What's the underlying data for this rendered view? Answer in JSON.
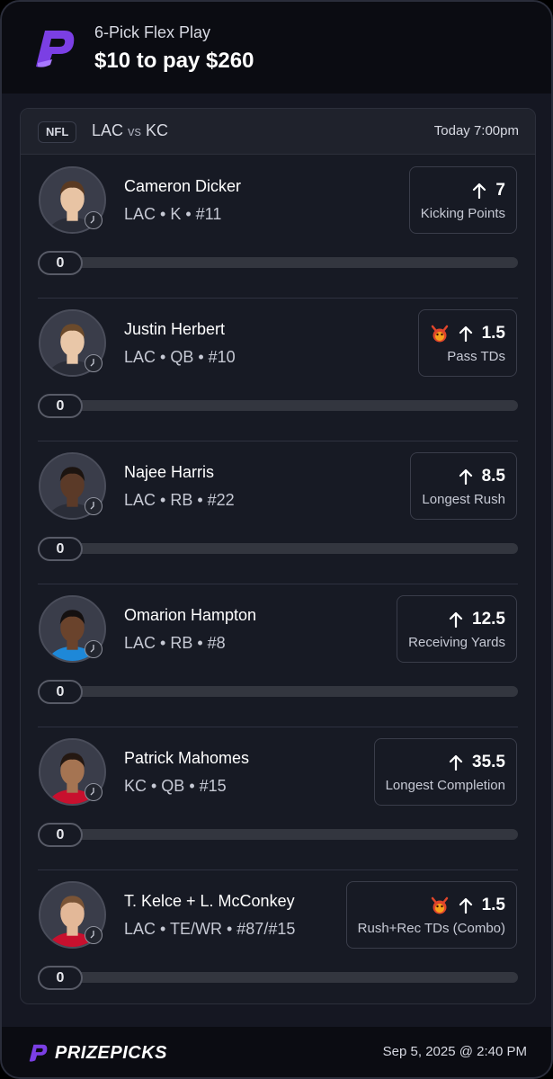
{
  "play": {
    "title": "6-Pick Flex Play",
    "stake": "$10 to pay $260"
  },
  "game": {
    "league": "NFL",
    "team_home": "LAC",
    "vs": "vs",
    "team_away": "KC",
    "time": "Today 7:00pm"
  },
  "picks": [
    {
      "name": "Cameron Dicker",
      "meta": "LAC • K • #11",
      "line": "7",
      "stat": "Kicking Points",
      "demon": false,
      "progress": "0",
      "skin": "#e8c4a4",
      "hair": "#5a3a22",
      "jersey": "#2a2d38"
    },
    {
      "name": "Justin Herbert",
      "meta": "LAC • QB • #10",
      "line": "1.5",
      "stat": "Pass TDs",
      "demon": true,
      "progress": "0",
      "skin": "#e9c7a8",
      "hair": "#6b4a2b",
      "jersey": "#2a2d38"
    },
    {
      "name": "Najee Harris",
      "meta": "LAC • RB • #22",
      "line": "8.5",
      "stat": "Longest Rush",
      "demon": false,
      "progress": "0",
      "skin": "#5b3a28",
      "hair": "#1c1410",
      "jersey": "#2a2d38"
    },
    {
      "name": "Omarion Hampton",
      "meta": "LAC • RB • #8",
      "line": "12.5",
      "stat": "Receiving Yards",
      "demon": false,
      "progress": "0",
      "skin": "#6a432c",
      "hair": "#141010",
      "jersey": "#1e88d8"
    },
    {
      "name": "Patrick Mahomes",
      "meta": "KC • QB • #15",
      "line": "35.5",
      "stat": "Longest Completion",
      "demon": false,
      "progress": "0",
      "skin": "#a57452",
      "hair": "#241812",
      "jersey": "#c8102e"
    },
    {
      "name": "T. Kelce + L. McConkey",
      "meta": "LAC • TE/WR • #87/#15",
      "line": "1.5",
      "stat": "Rush+Rec TDs (Combo)",
      "demon": true,
      "progress": "0",
      "skin": "#e3b898",
      "hair": "#7a5436",
      "jersey": "#c8102e"
    }
  ],
  "footer": {
    "brand": "PRIZEPICKS",
    "timestamp": "Sep 5, 2025 @ 2:40 PM"
  },
  "colors": {
    "brand_purple": "#7b3fe4",
    "background": "#151722",
    "card": "#171a24",
    "header": "#0b0c12"
  },
  "icons": {
    "logo": "prizepicks-logo-icon",
    "arrow": "arrow-up-icon",
    "demon": "demon-icon",
    "clock": "clock-icon"
  }
}
